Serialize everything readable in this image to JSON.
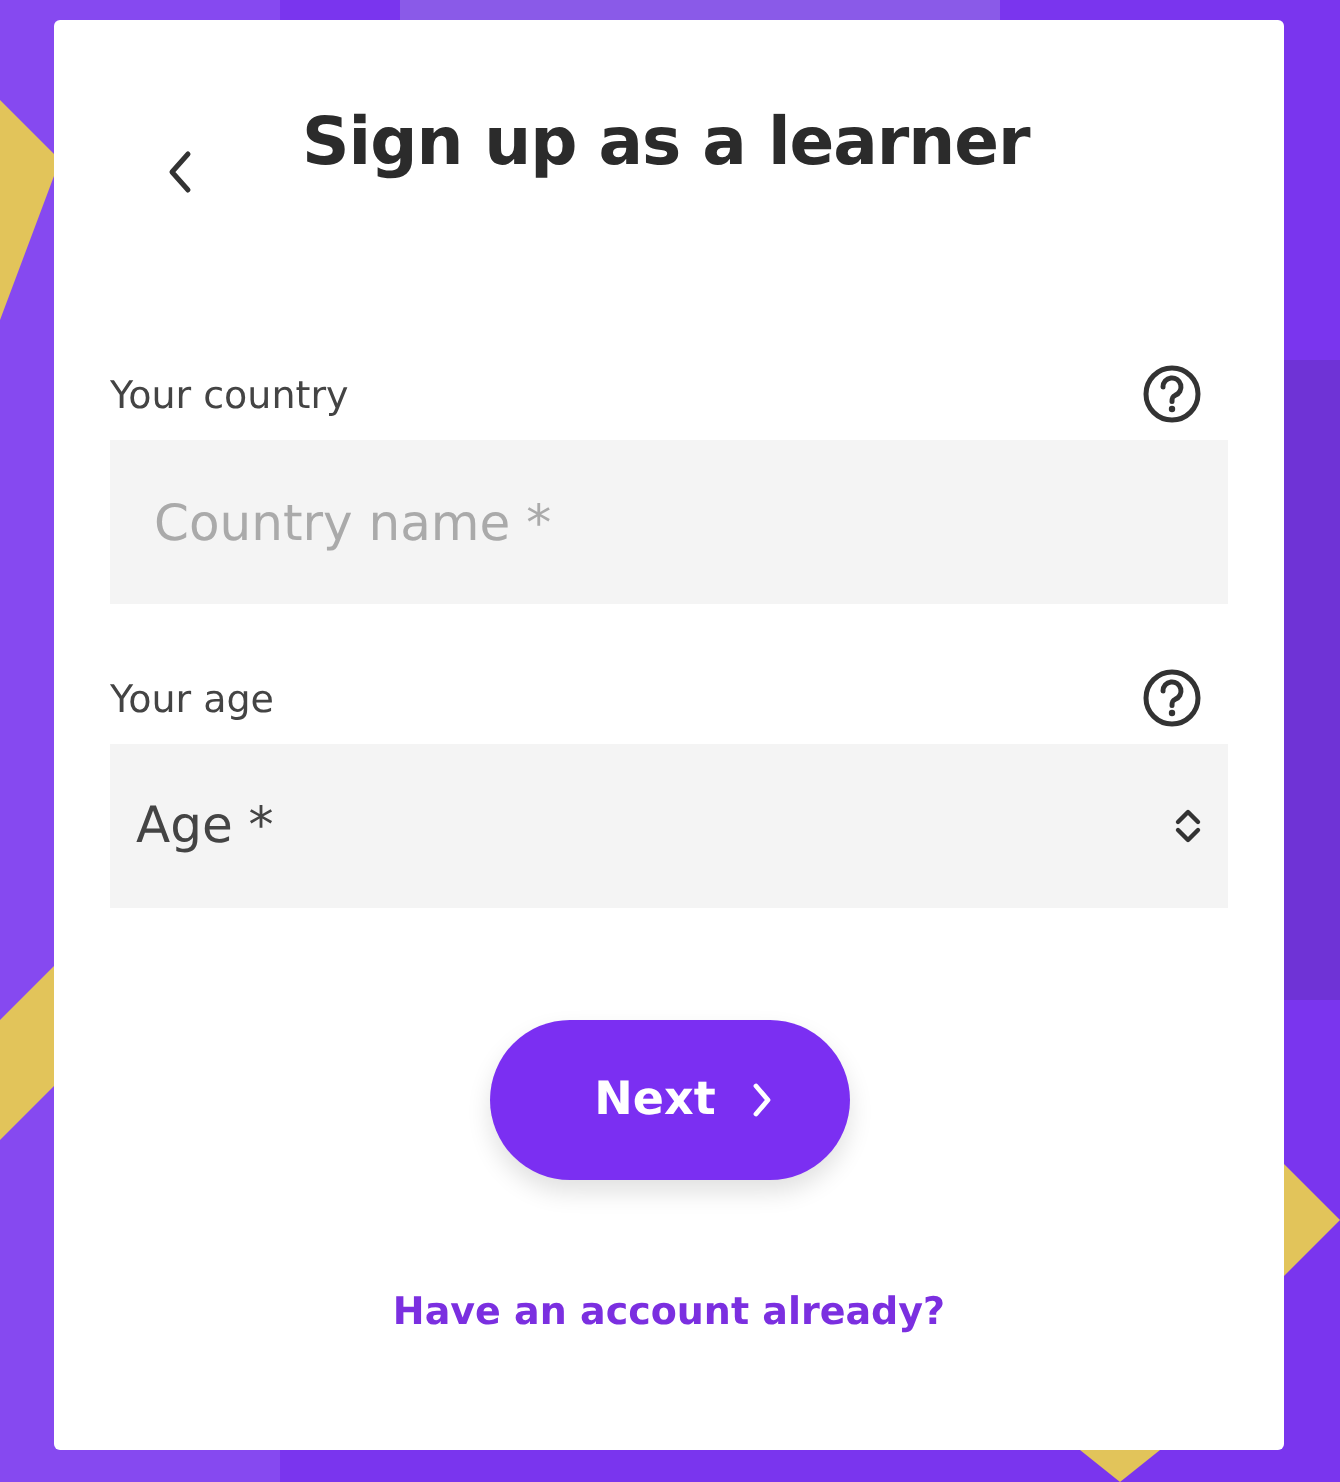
{
  "header": {
    "title": "Sign up as a learner"
  },
  "fields": [
    {
      "kind": "text",
      "label": "Your country",
      "placeholder": "Country name *"
    },
    {
      "kind": "select",
      "label": "Your age",
      "value": "Age *"
    }
  ],
  "next_button": {
    "label": "Next"
  },
  "login_link": "Have an account already?"
}
